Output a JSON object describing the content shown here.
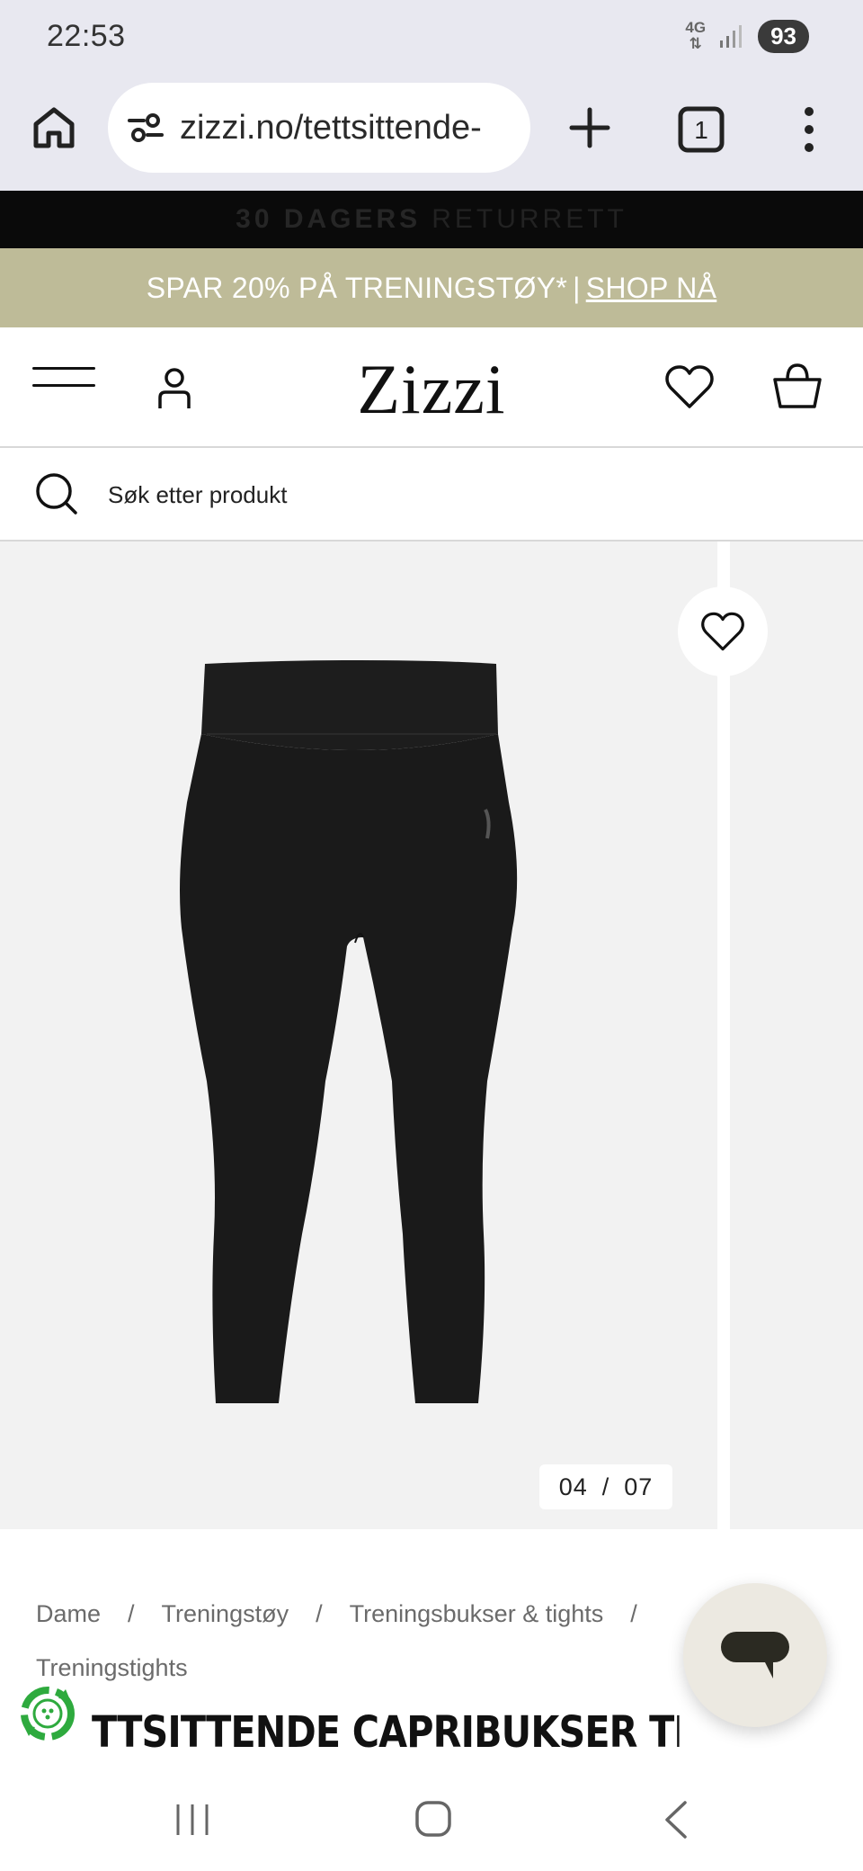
{
  "status_bar": {
    "time": "22:53",
    "network": "4G",
    "battery": "93"
  },
  "browser": {
    "url": "zizzi.no/tettsittende-",
    "tab_count": "1"
  },
  "promo_strip": {
    "bold": "30 DAGERS",
    "text": "RETURRETT"
  },
  "sale_banner": {
    "text": "SPAR 20% PÅ TRENINGSTØY*",
    "separator": "|",
    "link": "SHOP NÅ",
    "background_color": "#bebb98"
  },
  "header": {
    "logo": "Zizzi"
  },
  "search": {
    "placeholder": "Søk etter produkt"
  },
  "gallery": {
    "current": "04",
    "separator": "/",
    "total": "07"
  },
  "breadcrumb": {
    "items": [
      "Dame",
      "Treningstøy",
      "Treningsbukser & tights",
      "Treningstights"
    ],
    "separator": "/"
  },
  "product": {
    "title_visible": "TTSITTENDE CAPRIBUKSER TIL"
  },
  "icons": {
    "home": "home-icon",
    "site_settings": "tune-icon",
    "new_tab": "plus-icon",
    "tabs": "tab-switcher-icon",
    "menu": "more-vert-icon",
    "account": "user-icon",
    "wishlist": "heart-icon",
    "bag": "shopping-bag-icon",
    "search": "search-icon",
    "chat": "chat-icon",
    "recycle": "recycle-icon"
  }
}
